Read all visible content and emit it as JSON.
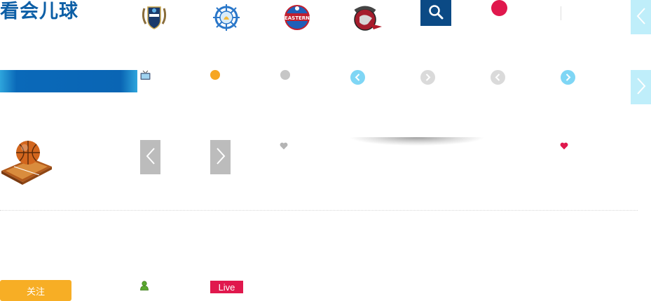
{
  "header": {
    "logo_text": "看会儿球",
    "teams": [
      {
        "icon": "kawasaki-frontale-logo-icon"
      },
      {
        "icon": "ship-wheel-team-logo-icon"
      },
      {
        "icon": "eastern-conference-logo-icon"
      },
      {
        "icon": "toronto-raptors-logo-icon"
      }
    ],
    "search_icon": "search-icon"
  },
  "follow_button": {
    "label": "关注"
  },
  "live_badge": {
    "label": "Live"
  },
  "colors": {
    "brand_blue": "#0d5fa6",
    "search_bg": "#0b4a85",
    "accent_red": "#e0184d",
    "orange": "#f7ae25",
    "cyan_light": "#bfeefa",
    "gray": "#bcbcbc"
  }
}
